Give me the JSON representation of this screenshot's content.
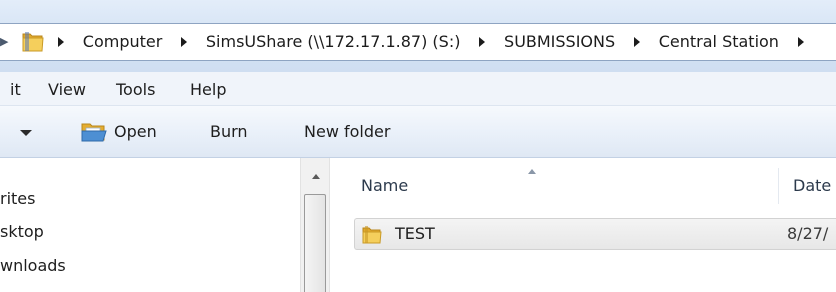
{
  "address_bar": {
    "nav_stub": "▶",
    "breadcrumbs": [
      "Computer",
      "SimsUShare (\\\\172.17.1.87) (S:)",
      "SUBMISSIONS",
      "Central Station"
    ]
  },
  "menu": {
    "items": [
      "it",
      "View",
      "Tools",
      "Help"
    ]
  },
  "command_bar": {
    "open_label": "Open",
    "burn_label": "Burn",
    "new_folder_label": "New folder"
  },
  "nav_pane": {
    "items": [
      "rites",
      "sktop",
      "wnloads"
    ]
  },
  "file_list": {
    "columns": {
      "name": "Name",
      "date": "Date"
    },
    "rows": [
      {
        "name": "TEST",
        "date": "8/27/"
      }
    ]
  },
  "colors": {
    "folder_yellow": "#f2c44a",
    "selection_gray": "#e7e7e7",
    "address_blue": "#d6e4f5"
  },
  "icons": {
    "address_folder": "folder-icon",
    "open": "open-folder-icon",
    "row_folder": "folder-icon"
  }
}
